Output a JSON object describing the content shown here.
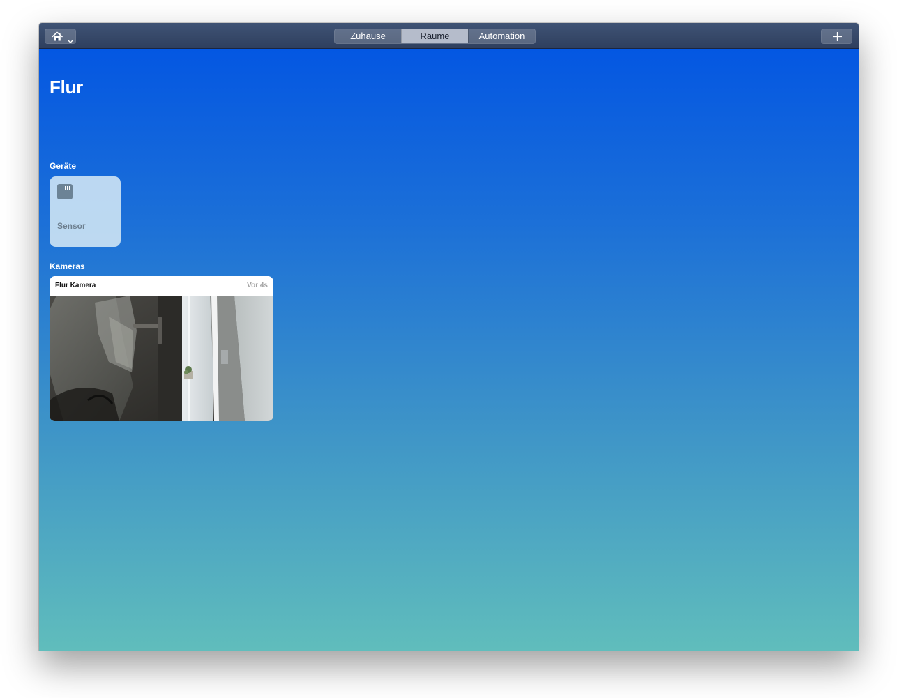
{
  "toolbar": {
    "home_icon": "house-icon",
    "home_menu_icon": "chevron-down-icon",
    "tabs": [
      {
        "label": "Zuhause",
        "active": false
      },
      {
        "label": "Räume",
        "active": true
      },
      {
        "label": "Automation",
        "active": false
      }
    ],
    "add_icon": "plus-icon"
  },
  "room": {
    "title": "Flur"
  },
  "devices": {
    "section_label": "Geräte",
    "items": [
      {
        "name": "Sensor",
        "icon": "sensor-icon"
      }
    ]
  },
  "cameras": {
    "section_label": "Kameras",
    "items": [
      {
        "name": "Flur Kamera",
        "timestamp": "Vor 4s"
      }
    ]
  },
  "colors": {
    "background_top": "#0457e2",
    "background_bottom": "#60bdbc",
    "titlebar": "#35476a",
    "active_tab": "#b5bccb"
  }
}
